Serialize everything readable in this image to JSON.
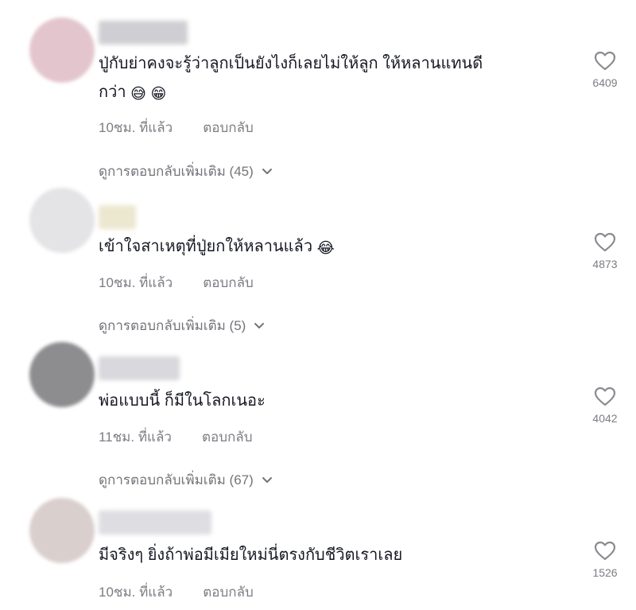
{
  "comments": [
    {
      "text_line1": "ปู่กับย่าคงจะรู้ว่าลูกเป็นยังไงก็เลยไม่ให้ลูก ให้หลานแทนดี",
      "text_line2": "กว่า",
      "emojis": [
        "😅",
        "😁"
      ],
      "time": "10ชม. ที่แล้ว",
      "reply_label": "ตอบกลับ",
      "more_replies": "ดูการตอบกลับเพิ่มเติม (45)",
      "likes": "6409",
      "avatar_color": "#e3c6cd",
      "username_color": "#cfcfd3"
    },
    {
      "text_line1": "เข้าใจสาเหตุที่ปู่ยกให้หลานแล้ว",
      "emojis": [
        "😂"
      ],
      "time": "10ชม. ที่แล้ว",
      "reply_label": "ตอบกลับ",
      "more_replies": "ดูการตอบกลับเพิ่มเติม (5)",
      "likes": "4873",
      "avatar_color": "#e4e3e6",
      "username_color": "#ece7cf"
    },
    {
      "text_line1": "พ่อแบบนี้ ก็มีในโลกเนอะ",
      "time": "11ชม. ที่แล้ว",
      "reply_label": "ตอบกลับ",
      "more_replies": "ดูการตอบกลับเพิ่มเติม (67)",
      "likes": "4042",
      "avatar_color": "#8d8c8f",
      "username_color": "#d7d7dc"
    },
    {
      "text_line1": "มีจริงๆ ยิ่งถ้าพ่อมีเมียใหม่นี่ตรงกับชีวิตเราเลย",
      "time": "10ชม. ที่แล้ว",
      "reply_label": "ตอบกลับ",
      "likes": "1526",
      "avatar_color": "#d9cfcd",
      "username_color": "#dddde2"
    }
  ],
  "icons": {
    "like": "heart-outline-icon",
    "expand": "chevron-down-icon"
  },
  "colors": {
    "text": "#161823",
    "meta": "#7c7d84",
    "icon": "#8a8b91"
  }
}
